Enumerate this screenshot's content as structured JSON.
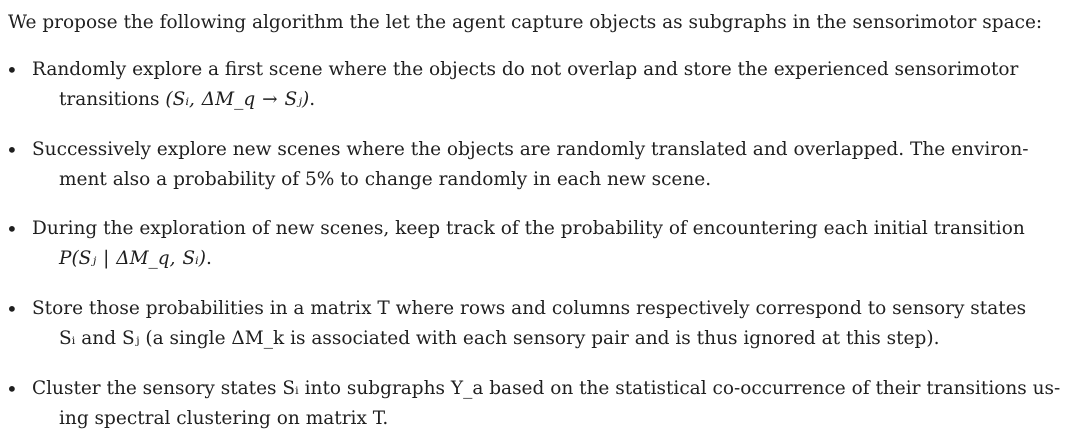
{
  "intro": "We propose the following algorithm the let the agent capture objects as subgraphs in the sensorimotor space:",
  "bullet_symbol": "•",
  "items": [
    {
      "line1": "Randomly explore a first scene where the objects do not overlap and store the experienced sensorimotor",
      "line2_text": "transitions ",
      "line2_math": "(Sᵢ, ΔM_q → Sⱼ)",
      "line2_tail": "."
    },
    {
      "line1": "Successively explore new scenes where the objects are randomly translated and overlapped. The environ-",
      "line2_text": "ment also a probability of 5% to change randomly in each new scene.",
      "line2_math": "",
      "line2_tail": ""
    },
    {
      "line1": "During the exploration of new scenes, keep track of the probability of encountering each initial transition",
      "line2_text": "",
      "line2_math": "P(Sⱼ | ΔM_q, Sᵢ)",
      "line2_tail": "."
    },
    {
      "line1": "Store those probabilities in a matrix T where rows and columns respectively correspond to sensory states",
      "line2_text": "Sᵢ and Sⱼ (a single ΔM_k is associated with each sensory pair and is thus ignored at this step).",
      "line2_math": "",
      "line2_tail": ""
    },
    {
      "line1": "Cluster the sensory states Sᵢ into subgraphs Y_a based on the statistical co-occurrence of their transitions us-",
      "line2_text": "ing spectral clustering on matrix T.",
      "line2_math": "",
      "line2_tail": ""
    }
  ]
}
